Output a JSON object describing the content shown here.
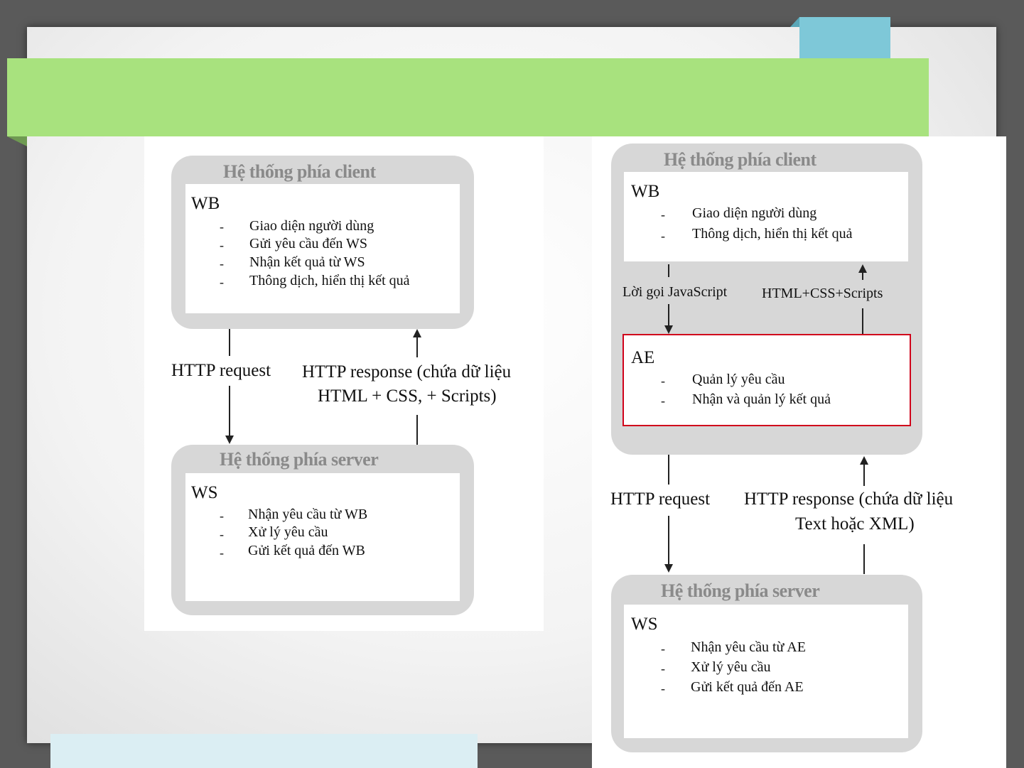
{
  "left": {
    "client_title": "Hệ thống phía client",
    "client_node": "WB",
    "client_items": [
      "Giao diện người dùng",
      "Gửi yêu cầu đến WS",
      "Nhận kết quả từ WS",
      "Thông dịch, hiển thị kết quả"
    ],
    "request_label": "HTTP request",
    "response_line1": "HTTP response (chứa dữ liệu",
    "response_line2": "HTML + CSS, + Scripts)",
    "server_title": "Hệ thống phía server",
    "server_node": "WS",
    "server_items": [
      "Nhận yêu cầu từ WB",
      "Xử lý yêu cầu",
      "Gửi kết quả đến WB"
    ]
  },
  "right": {
    "client_title": "Hệ thống phía client",
    "wb_node": "WB",
    "wb_items": [
      "Giao diện người dùng",
      "Thông dịch, hiển thị kết quả"
    ],
    "js_call_label": "Lời gọi JavaScript",
    "html_label": "HTML+CSS+Scripts",
    "ae_node": "AE",
    "ae_items": [
      "Quản lý yêu cầu",
      "Nhận và quản lý kết quả"
    ],
    "request_label": "HTTP request",
    "response_line1": "HTTP response (chứa dữ liệu",
    "response_line2": "Text hoặc XML)",
    "server_title": "Hệ thống phía server",
    "server_node": "WS",
    "server_items": [
      "Nhận yêu cầu từ AE",
      "Xử lý yêu cầu",
      "Gửi kết quả đến AE"
    ]
  },
  "colors": {
    "title_bar": "#a8e27e",
    "tab": "#7ec8d8",
    "highlight": "#d0021b",
    "box": "#d7d7d7"
  }
}
